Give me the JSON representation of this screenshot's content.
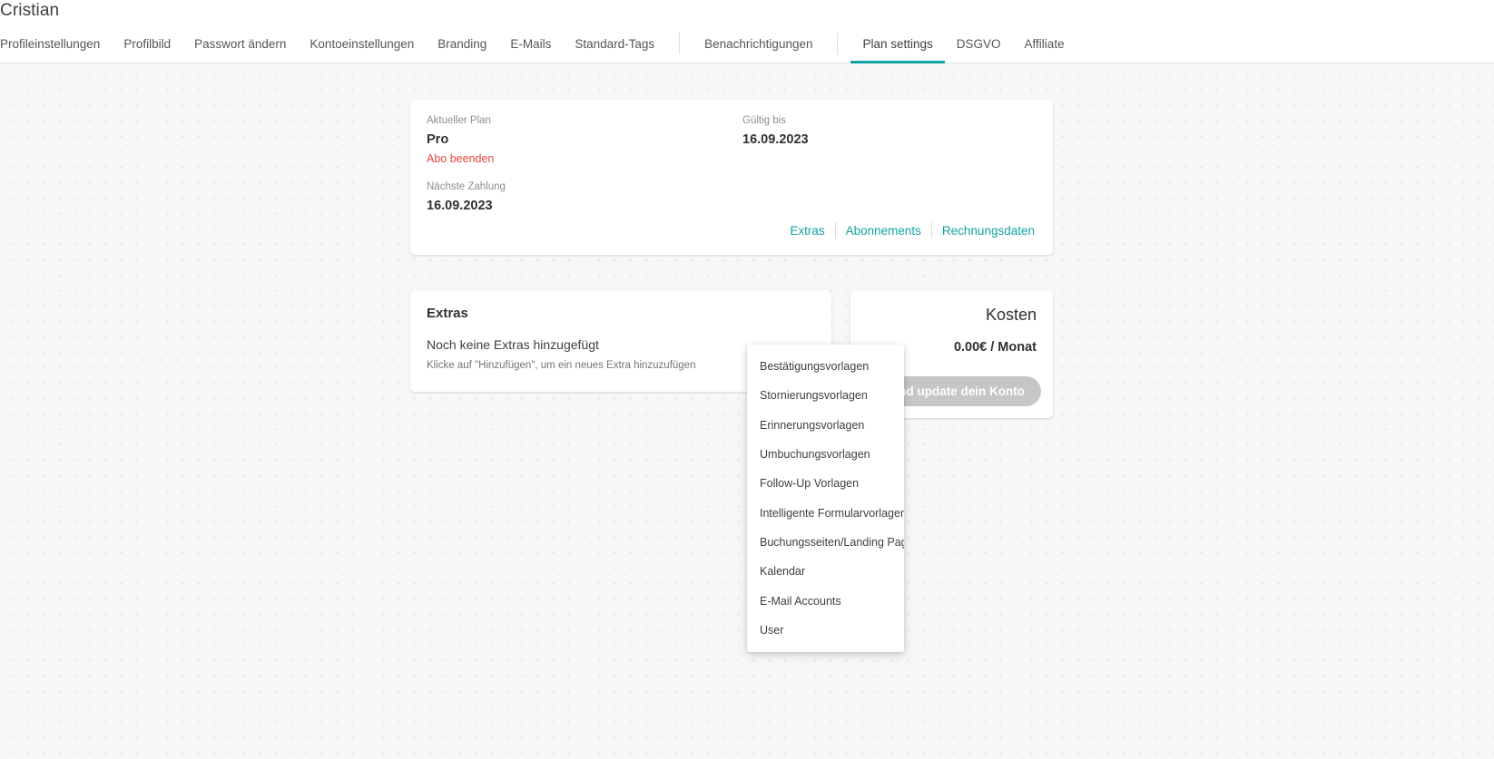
{
  "header": {
    "title": "Cristian",
    "tabs": [
      {
        "label": "Profileinstellungen",
        "active": false
      },
      {
        "label": "Profilbild",
        "active": false
      },
      {
        "label": "Passwort ändern",
        "active": false
      },
      {
        "label": "Kontoeinstellungen",
        "active": false
      },
      {
        "label": "Branding",
        "active": false
      },
      {
        "label": "E-Mails",
        "active": false
      },
      {
        "label": "Standard-Tags",
        "active": false
      },
      {
        "label": "Benachrichtigungen",
        "active": false
      },
      {
        "label": "Plan settings",
        "active": true
      },
      {
        "label": "DSGVO",
        "active": false
      },
      {
        "label": "Affiliate",
        "active": false
      }
    ]
  },
  "plan_card": {
    "current_plan_label": "Aktueller Plan",
    "current_plan_value": "Pro",
    "cancel_link": "Abo beenden",
    "next_payment_label": "Nächste Zahlung",
    "next_payment_value": "16.09.2023",
    "valid_until_label": "Gültig bis",
    "valid_until_value": "16.09.2023",
    "links": [
      "Extras",
      "Abonnements",
      "Rechnungsdaten"
    ]
  },
  "extras_card": {
    "title": "Extras",
    "empty_text": "Noch keine Extras hinzugefügt",
    "hint_text": "Klicke auf \"Hinzufügen\", um ein neues Extra hinzuzufügen"
  },
  "kosten_card": {
    "title": "Kosten",
    "amount": "0.00€ / Monat",
    "button_label": "Speichere und update dein Konto"
  },
  "extras_dropdown": {
    "items": [
      "Bestätigungsvorlagen",
      "Stornierungsvorlagen",
      "Erinnerungsvorlagen",
      "Umbuchungsvorlagen",
      "Follow-Up Vorlagen",
      "Intelligente Formularvorlagen",
      "Buchungsseiten/Landing Pages",
      "Kalendar",
      "E-Mail Accounts",
      "User"
    ]
  },
  "colors": {
    "accent": "#16a2a2",
    "danger": "#e8453c",
    "disabled_button": "#c6c6c6",
    "background": "#f7f7f8"
  }
}
